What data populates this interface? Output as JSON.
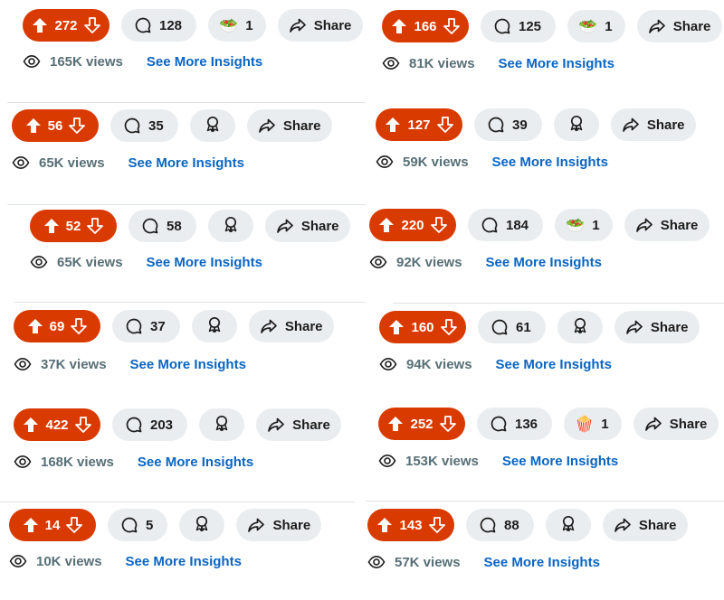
{
  "share_label": "Share",
  "insights_label": "See More Insights",
  "colors": {
    "upvote_bg": "#d93a00",
    "pill_bg": "#eaedef",
    "link": "#0a65c2",
    "muted": "#576f76"
  },
  "posts": [
    {
      "votes": "272",
      "comments": "128",
      "award_count": "1",
      "award_icon": "salad-bowl-emoji",
      "views": "165K views"
    },
    {
      "votes": "166",
      "comments": "125",
      "award_count": "1",
      "award_icon": "salad-bowl-emoji",
      "views": "81K views"
    },
    {
      "votes": "56",
      "comments": "35",
      "award_count": null,
      "award_icon": "award-ribbon-icon",
      "views": "65K views"
    },
    {
      "votes": "127",
      "comments": "39",
      "award_count": null,
      "award_icon": "award-ribbon-icon",
      "views": "59K views"
    },
    {
      "votes": "52",
      "comments": "58",
      "award_count": null,
      "award_icon": "award-ribbon-icon",
      "views": "65K views"
    },
    {
      "votes": "220",
      "comments": "184",
      "award_count": "1",
      "award_icon": "salad-bowl-emoji",
      "views": "92K views"
    },
    {
      "votes": "69",
      "comments": "37",
      "award_count": null,
      "award_icon": "award-ribbon-icon",
      "views": "37K views"
    },
    {
      "votes": "160",
      "comments": "61",
      "award_count": null,
      "award_icon": "award-ribbon-icon",
      "views": "94K views"
    },
    {
      "votes": "422",
      "comments": "203",
      "award_count": null,
      "award_icon": "award-ribbon-icon",
      "views": "168K views"
    },
    {
      "votes": "252",
      "comments": "136",
      "award_count": "1",
      "award_icon": "popcorn-emoji",
      "views": "153K views"
    },
    {
      "votes": "14",
      "comments": "5",
      "award_count": null,
      "award_icon": "award-ribbon-icon",
      "views": "10K views"
    },
    {
      "votes": "143",
      "comments": "88",
      "award_count": null,
      "award_icon": "award-ribbon-icon",
      "views": "57K views"
    }
  ]
}
